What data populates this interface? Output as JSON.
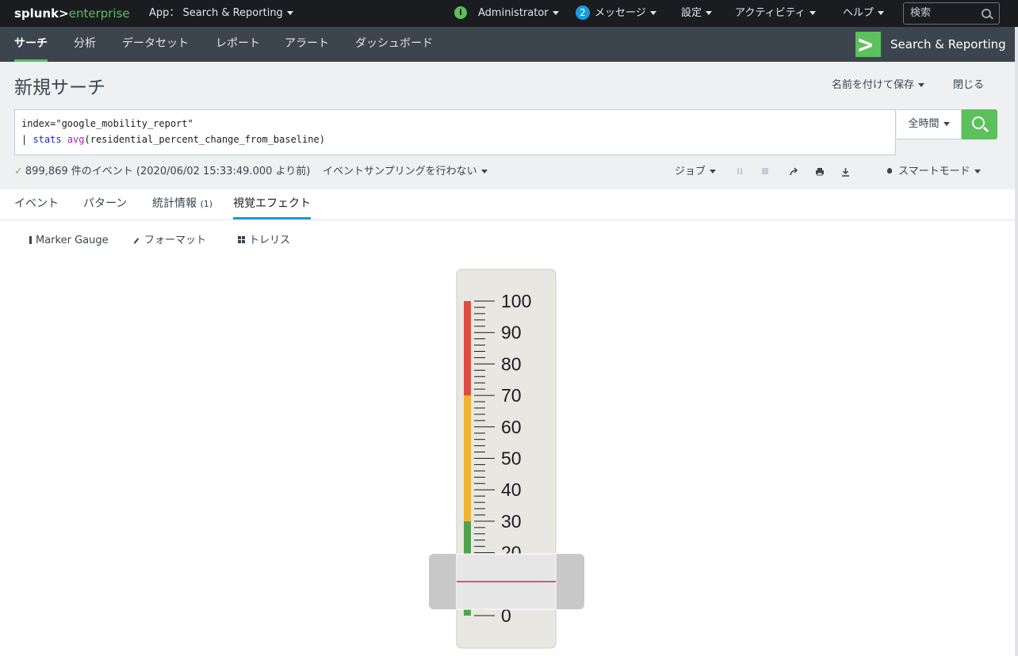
{
  "topbar": {
    "logo_splunk": "splunk>",
    "logo_product": "enterprise",
    "app_label": "App：",
    "app_name": "Search & Reporting",
    "user": "Administrator",
    "messages_count": "2",
    "messages_label": "メッセージ",
    "settings": "設定",
    "activity": "アクティビティ",
    "help": "ヘルプ",
    "search_placeholder": "検索",
    "info_icon_glyph": "i"
  },
  "appnav": {
    "tabs": [
      "サーチ",
      "分析",
      "データセット",
      "レポート",
      "アラート",
      "ダッシュボード"
    ],
    "app_title": "Search & Reporting"
  },
  "search": {
    "page_title": "新規サーチ",
    "save_as": "名前を付けて保存",
    "close": "閉じる",
    "query_line1": "index=\"google_mobility_report\"",
    "query_pipe": "| ",
    "query_cmd": "stats",
    "query_fn": "avg",
    "query_args": "(residential_percent_change_from_baseline)",
    "time_range": "全時間",
    "status_check": "✓",
    "event_count": "899,869 件のイベント (2020/06/02 15:33:49.000 より前)",
    "sampling": "イベントサンプリングを行わない",
    "job": "ジョブ",
    "mode": "スマートモード"
  },
  "tabs": {
    "events": "イベント",
    "patterns": "パターン",
    "statistics": "統計情報",
    "statistics_count": "(1)",
    "visualization": "視覚エフェクト"
  },
  "viz_toolbar": {
    "type": "Marker Gauge",
    "format": "フォーマット",
    "trellis": "トレリス"
  },
  "gauge": {
    "min": 0,
    "max": 100,
    "value": 10.8,
    "major_step": 10,
    "minor_step": 2,
    "ranges": [
      {
        "from": 0,
        "to": 30,
        "color": "#53a051"
      },
      {
        "from": 30,
        "to": 70,
        "color": "#f1b334"
      },
      {
        "from": 70,
        "to": 100,
        "color": "#dc4e41"
      }
    ],
    "marker_color": "#d0021b",
    "background_color": "#e8e7e1"
  },
  "colors": {
    "accent_green": "#5cc05c",
    "accent_blue": "#1a9cdc",
    "topbar_bg": "#1a1c20",
    "appnav_bg": "#3c444d"
  }
}
